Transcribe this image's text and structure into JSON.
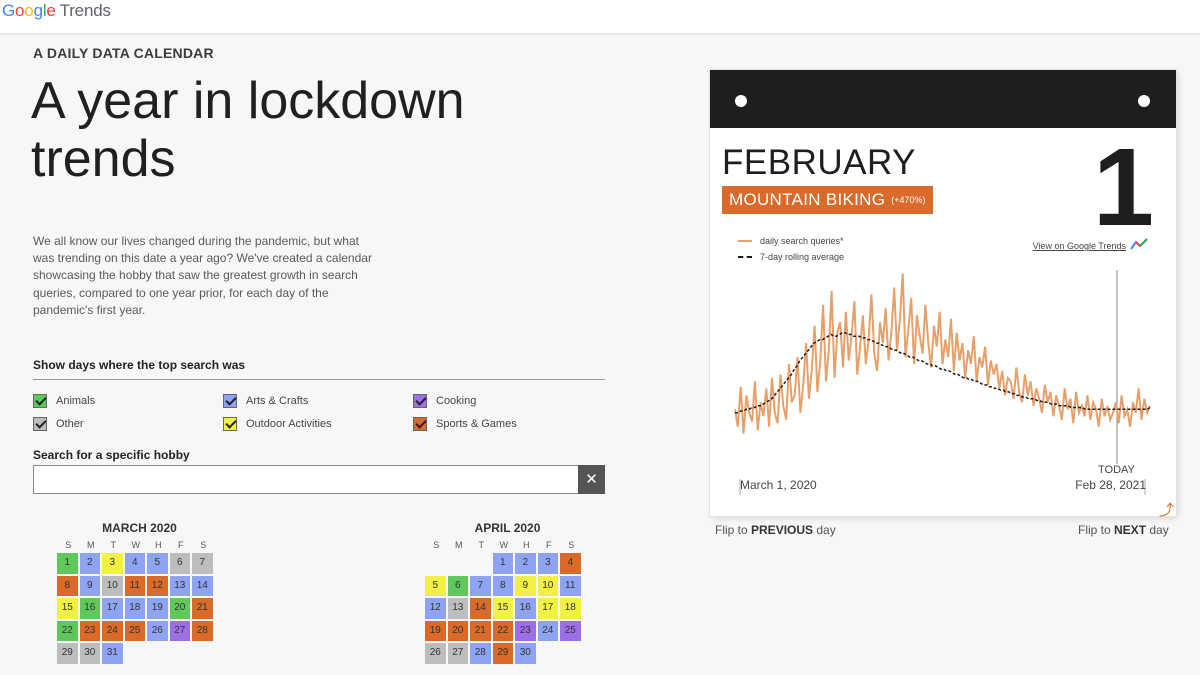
{
  "header": {
    "logo_word": "Google",
    "logo_product": "Trends"
  },
  "kicker": "A DAILY DATA CALENDAR",
  "title": "A year in lockdown trends",
  "intro": "We all know our lives changed during the pandemic, but what was trending on this date a year ago? We've created a calendar showcasing the hobby that saw the greatest growth in search queries, compared to one year prior, for each day of the pandemic's first year.",
  "filters": {
    "heading": "Show days where the top search was",
    "items": [
      {
        "label": "Animals",
        "color": "#5ec95a"
      },
      {
        "label": "Arts & Crafts",
        "color": "#8ea4f2"
      },
      {
        "label": "Cooking",
        "color": "#9d6fe6"
      },
      {
        "label": "Other",
        "color": "#bdbdbd"
      },
      {
        "label": "Outdoor Activities",
        "color": "#f0f045"
      },
      {
        "label": "Sports & Games",
        "color": "#d96a29"
      }
    ]
  },
  "search": {
    "heading": "Search for a specific hobby",
    "value": "",
    "placeholder": "",
    "clear_icon": "close-icon",
    "clear_label": "✕"
  },
  "calendar": {
    "weekday_labels": [
      "S",
      "M",
      "T",
      "W",
      "H",
      "F",
      "S"
    ],
    "category_colors": {
      "animals": "#5ec95a",
      "arts": "#8ea4f2",
      "cooking": "#9d6fe6",
      "other": "#bdbdbd",
      "outdoor": "#f0f045",
      "sports": "#d96a29"
    },
    "months": [
      {
        "name": "MARCH 2020",
        "start_offset": 0,
        "days": [
          "animals",
          "arts",
          "outdoor",
          "arts",
          "arts",
          "other",
          "other",
          "sports",
          "arts",
          "other",
          "sports",
          "sports",
          "arts",
          "arts",
          "outdoor",
          "animals",
          "arts",
          "arts",
          "arts",
          "animals",
          "sports",
          "animals",
          "sports",
          "sports",
          "sports",
          "arts",
          "cooking",
          "sports",
          "other",
          "other",
          "arts"
        ]
      },
      {
        "name": "APRIL 2020",
        "start_offset": 3,
        "days": [
          "arts",
          "arts",
          "arts",
          "sports",
          "outdoor",
          "animals",
          "arts",
          "arts",
          "outdoor",
          "outdoor",
          "arts",
          "arts",
          "other",
          "sports",
          "outdoor",
          "arts",
          "outdoor",
          "outdoor",
          "sports",
          "sports",
          "sports",
          "sports",
          "cooking",
          "arts",
          "cooking",
          "other",
          "other",
          "arts",
          "sports",
          "arts"
        ]
      }
    ]
  },
  "card": {
    "month": "FEBRUARY",
    "day": "1",
    "hobby": "MOUNTAIN BIKING",
    "hobby_change": "(+470%)",
    "legend_daily": "daily search queries*",
    "legend_avg": "7-day rolling average",
    "link_text": "View on Google Trends",
    "x_start": "March 1, 2020",
    "x_end": "Feb 28, 2021",
    "today_label": "TODAY",
    "series_color": "#e8a06a",
    "avg_color": "#1e1e1e",
    "chart_data": {
      "type": "line",
      "x_range": [
        "March 1, 2020",
        "Feb 28, 2021"
      ],
      "series": [
        {
          "name": "daily search queries*",
          "values": [
            32,
            22,
            45,
            18,
            40,
            30,
            25,
            48,
            20,
            36,
            28,
            44,
            22,
            50,
            30,
            24,
            52,
            34,
            26,
            58,
            36,
            40,
            62,
            30,
            46,
            70,
            38,
            54,
            80,
            42,
            60,
            92,
            48,
            66,
            100,
            50,
            76,
            82,
            56,
            88,
            60,
            74,
            94,
            52,
            68,
            86,
            58,
            72,
            98,
            64,
            54,
            82,
            70,
            90,
            60,
            76,
            102,
            66,
            84,
            110,
            62,
            78,
            96,
            58,
            86,
            74,
            64,
            92,
            70,
            56,
            80,
            68,
            88,
            58,
            72,
            62,
            84,
            54,
            76,
            60,
            70,
            50,
            66,
            58,
            74,
            48,
            62,
            56,
            68,
            46,
            60,
            52,
            58,
            44,
            54,
            40,
            50,
            48,
            38,
            56,
            42,
            36,
            52,
            40,
            48,
            34,
            44,
            38,
            30,
            46,
            36,
            42,
            28,
            40,
            34,
            26,
            44,
            32,
            38,
            24,
            42,
            30,
            34,
            28,
            40,
            26,
            36,
            32,
            22,
            38,
            28,
            34,
            26,
            30,
            36,
            24,
            40,
            28,
            32,
            22,
            36,
            30,
            44,
            26,
            38,
            30,
            34
          ]
        },
        {
          "name": "7-day rolling average",
          "values": [
            30,
            30,
            31,
            31,
            32,
            32,
            33,
            33,
            34,
            34,
            35,
            36,
            37,
            38,
            40,
            42,
            44,
            46,
            48,
            50,
            52,
            55,
            57,
            60,
            62,
            64,
            66,
            68,
            70,
            71,
            72,
            72,
            73,
            74,
            75,
            74,
            74,
            75,
            76,
            76,
            75,
            75,
            74,
            74,
            74,
            73,
            73,
            72,
            72,
            71,
            70,
            70,
            69,
            68,
            68,
            67,
            66,
            66,
            65,
            64,
            64,
            63,
            62,
            62,
            61,
            60,
            60,
            59,
            58,
            58,
            57,
            57,
            56,
            55,
            55,
            54,
            54,
            53,
            52,
            52,
            51,
            50,
            50,
            49,
            49,
            48,
            48,
            47,
            46,
            46,
            45,
            45,
            44,
            44,
            43,
            43,
            42,
            42,
            41,
            41,
            40,
            40,
            39,
            39,
            38,
            38,
            38,
            37,
            37,
            36,
            36,
            36,
            35,
            35,
            35,
            34,
            34,
            34,
            34,
            33,
            33,
            33,
            33,
            33,
            32,
            32,
            32,
            32,
            32,
            32,
            32,
            32,
            32,
            32,
            32,
            32,
            32,
            32,
            32,
            32,
            32,
            32,
            32,
            32,
            32,
            32,
            32,
            33
          ]
        }
      ]
    }
  },
  "nav": {
    "prev_prefix": "Flip to ",
    "prev_bold": "PREVIOUS",
    "prev_suffix": " day",
    "next_prefix": "Flip to ",
    "next_bold": "NEXT",
    "next_suffix": " day"
  }
}
